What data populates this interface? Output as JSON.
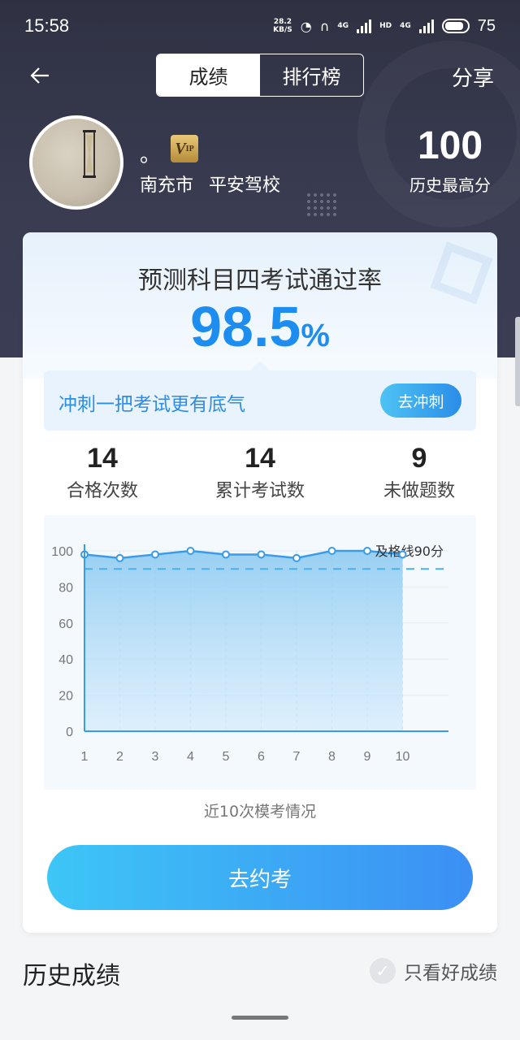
{
  "status_bar": {
    "time": "15:58",
    "net_speed_top": "28.2",
    "net_speed_bottom": "KB/S",
    "signal_1": "4G",
    "hd": "HD",
    "signal_2": "4G",
    "battery": "75"
  },
  "nav": {
    "tabs": [
      {
        "label": "成绩"
      },
      {
        "label": "排行榜"
      }
    ],
    "share": "分享"
  },
  "profile": {
    "name": "。",
    "vip_label": "V",
    "vip_suffix": "IP",
    "location": "南充市 平安驾校",
    "high_score": "100",
    "high_score_label": "历史最高分"
  },
  "prediction": {
    "title": "预测科目四考试通过率",
    "rate": "98.5",
    "rate_unit": "%"
  },
  "sprint": {
    "text": "冲刺一把考试更有底气",
    "button": "去冲刺"
  },
  "stats": [
    {
      "value": "14",
      "label": "合格次数"
    },
    {
      "value": "14",
      "label": "累计考试数"
    },
    {
      "value": "9",
      "label": "未做题数"
    }
  ],
  "chart_data": {
    "type": "area",
    "x": [
      1,
      2,
      3,
      4,
      5,
      6,
      7,
      8,
      9,
      10
    ],
    "values": [
      98,
      96,
      98,
      100,
      98,
      98,
      96,
      100,
      100,
      98
    ],
    "ylim": [
      0,
      100
    ],
    "yticks": [
      0,
      20,
      40,
      60,
      80,
      100
    ],
    "threshold": 90,
    "threshold_label": "及格线90分",
    "caption": "近10次模考情况",
    "color": "#3a9be8"
  },
  "book_button": "去约考",
  "history": {
    "title": "历史成绩",
    "filter_label": "只看好成绩"
  }
}
